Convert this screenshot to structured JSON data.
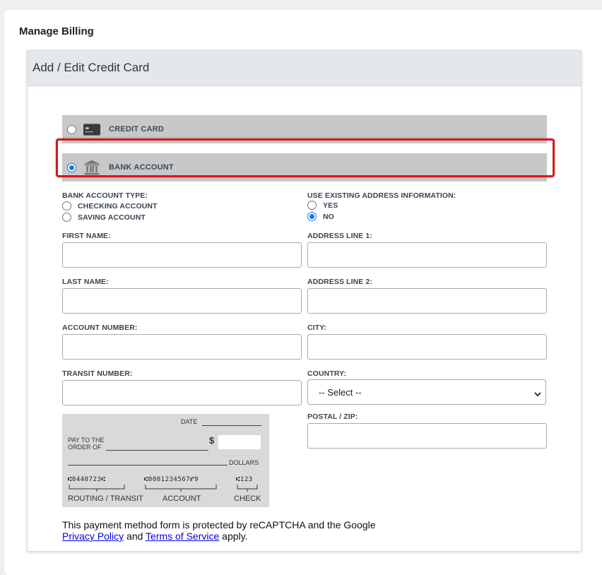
{
  "page": {
    "title": "Manage Billing"
  },
  "card": {
    "header": "Add / Edit Credit Card"
  },
  "payment_options": [
    {
      "label": "CREDIT CARD",
      "icon": "credit-card-icon",
      "selected": false
    },
    {
      "label": "BANK ACCOUNT",
      "icon": "bank-icon",
      "selected": true
    }
  ],
  "bank_account_type": {
    "label": "BANK ACCOUNT TYPE:",
    "options": [
      {
        "label": "CHECKING ACCOUNT",
        "selected": false
      },
      {
        "label": "SAVING ACCOUNT",
        "selected": false
      }
    ]
  },
  "use_existing_address": {
    "label": "USE EXISTING ADDRESS INFORMATION:",
    "options": [
      {
        "label": "YES",
        "selected": false
      },
      {
        "label": "NO",
        "selected": true
      }
    ]
  },
  "fields": {
    "first_name": {
      "label": "FIRST NAME:",
      "value": ""
    },
    "last_name": {
      "label": "LAST NAME:",
      "value": ""
    },
    "account_number": {
      "label": "ACCOUNT NUMBER:",
      "value": ""
    },
    "transit_number": {
      "label": "TRANSIT NUMBER:",
      "value": ""
    },
    "address_line_1": {
      "label": "ADDRESS LINE 1:",
      "value": ""
    },
    "address_line_2": {
      "label": "ADDRESS LINE 2:",
      "value": ""
    },
    "city": {
      "label": "CITY:",
      "value": ""
    },
    "country": {
      "label": "COUNTRY:",
      "value": "-- Select --"
    },
    "postal_zip": {
      "label": "POSTAL / ZIP:",
      "value": ""
    }
  },
  "check_image": {
    "date": "DATE",
    "pay_to_line1": "PAY TO THE",
    "pay_to_line2": "ORDER OF",
    "dollar_sign": "$",
    "dollars": "DOLLARS",
    "micr_routing": "⑆0440723⑆",
    "micr_account": "⑆0001234567⑈9",
    "micr_check": "⑆123",
    "routing_label": "ROUTING / TRANSIT",
    "account_label": "ACCOUNT",
    "check_label": "CHECK"
  },
  "footer": {
    "text1": "This payment method form is protected by reCAPTCHA and the Google",
    "privacy_link": "Privacy Policy",
    "and": "and",
    "terms_link": "Terms of Service",
    "apply": "apply."
  },
  "colors": {
    "highlight": "#d9161b",
    "radio_selected": "#1a73e8",
    "option_bar": "#c8c8c8",
    "header_bg": "#e4e8ed"
  }
}
